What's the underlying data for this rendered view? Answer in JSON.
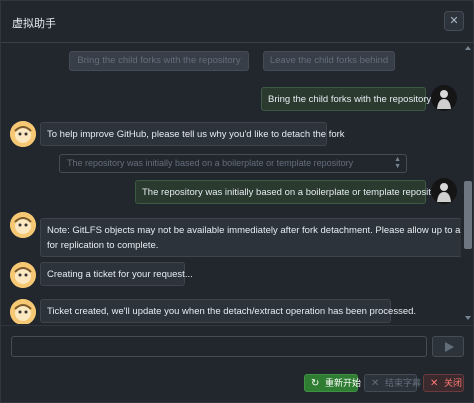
{
  "window": {
    "title": "虚拟助手",
    "close_glyph": "✕"
  },
  "options": [
    {
      "label": "Bring the child forks with the repository"
    },
    {
      "label": "Leave the child forks behind"
    }
  ],
  "messages": [
    {
      "role": "user",
      "text": "Bring the child forks with the repository"
    },
    {
      "role": "bot",
      "text": "To help improve GitHub, please tell us why you'd like to detach the fork"
    },
    {
      "role": "select",
      "text": "The repository was initially based on a boilerplate or template repository"
    },
    {
      "role": "user",
      "text": "The repository was initially based on a boilerplate or template repository"
    },
    {
      "role": "bot",
      "lines": [
        "Note: GitLFS objects may not be available immediately after fork detachment. Please allow up to an hour",
        "for replication to complete."
      ]
    },
    {
      "role": "bot",
      "text": "Creating a ticket for your request..."
    },
    {
      "role": "bot",
      "text": "Ticket created, we'll update you when the detach/extract operation has been processed."
    }
  ],
  "composer": {
    "value": "",
    "placeholder": ""
  },
  "footer": {
    "restart_label": "重新开始",
    "end_label": "结束字幕",
    "close_label": "关闭",
    "restart_icon": "↻",
    "end_icon": "✕",
    "close_icon": "✕"
  },
  "icons": {
    "bot_avatar": "robot-face-icon",
    "user_avatar": "user-figure-icon",
    "send": "send-arrow-icon"
  },
  "colors": {
    "accent_green": "#2e7d32",
    "danger": "#ff7b72",
    "background": "#22272e"
  }
}
